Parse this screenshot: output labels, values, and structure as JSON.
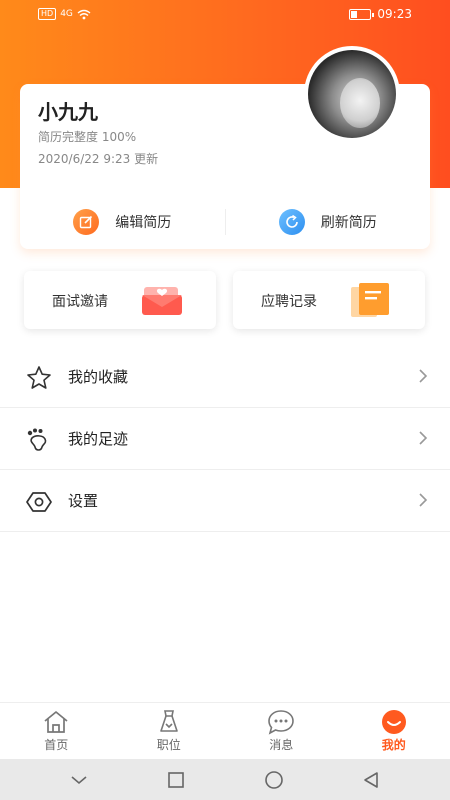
{
  "status_bar": {
    "network": "HD",
    "signal": "4G",
    "time": "09:23"
  },
  "profile": {
    "name": "小九九",
    "resume_completeness": "简历完整度 100%",
    "updated": "2020/6/22 9:23 更新",
    "actions": [
      {
        "label": "编辑简历",
        "icon": "edit-icon"
      },
      {
        "label": "刷新简历",
        "icon": "refresh-icon"
      }
    ]
  },
  "quick_cards": [
    {
      "label": "面试邀请",
      "icon": "invitation-envelope-icon"
    },
    {
      "label": "应聘记录",
      "icon": "application-records-icon"
    }
  ],
  "menu": [
    {
      "label": "我的收藏",
      "icon": "star-icon"
    },
    {
      "label": "我的足迹",
      "icon": "footprint-icon"
    },
    {
      "label": "设置",
      "icon": "settings-icon"
    }
  ],
  "bottom_nav": [
    {
      "label": "首页",
      "icon": "home-icon"
    },
    {
      "label": "职位",
      "icon": "job-icon"
    },
    {
      "label": "消息",
      "icon": "message-icon"
    },
    {
      "label": "我的",
      "icon": "mine-icon",
      "active": true
    }
  ],
  "colors": {
    "accent": "#ff5a1f",
    "header_gradient_start": "#ff8a1a",
    "header_gradient_end": "#ff4e1f"
  }
}
